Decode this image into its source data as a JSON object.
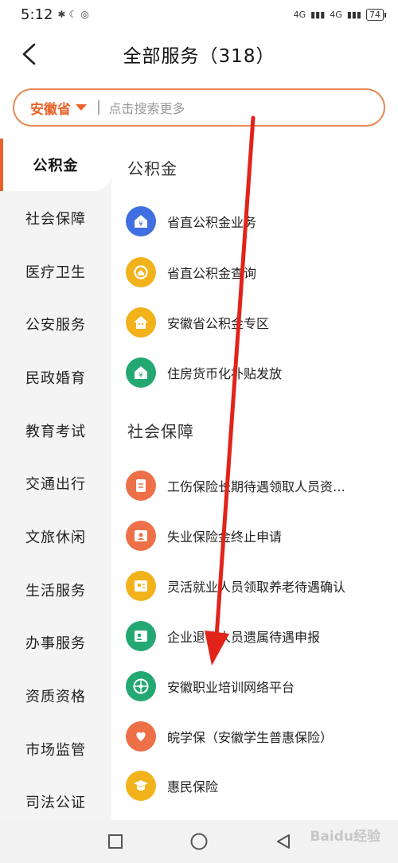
{
  "status_bar": {
    "time": "5:12",
    "network": "4G",
    "battery": "74"
  },
  "header": {
    "title": "全部服务（318）"
  },
  "search": {
    "province": "安徽省",
    "placeholder": "点击搜索更多"
  },
  "sidebar": {
    "items": [
      {
        "label": "公积金",
        "active": true
      },
      {
        "label": "社会保障"
      },
      {
        "label": "医疗卫生"
      },
      {
        "label": "公安服务"
      },
      {
        "label": "民政婚育"
      },
      {
        "label": "教育考试"
      },
      {
        "label": "交通出行"
      },
      {
        "label": "文旅休闲"
      },
      {
        "label": "生活服务"
      },
      {
        "label": "办事服务"
      },
      {
        "label": "资质资格"
      },
      {
        "label": "市场监管"
      },
      {
        "label": "司法公证"
      }
    ]
  },
  "sections": [
    {
      "title": "公积金",
      "items": [
        {
          "label": "省直公积金业务",
          "icon": "house-yen-icon",
          "color": "#3f6fe0"
        },
        {
          "label": "省直公积金查询",
          "icon": "search-house-icon",
          "color": "#f2b21b"
        },
        {
          "label": "安徽省公积金专区",
          "icon": "house-zone-icon",
          "color": "#f2b21b"
        },
        {
          "label": "住房货币化补贴发放",
          "icon": "house-subsidy-icon",
          "color": "#23a872"
        }
      ]
    },
    {
      "title": "社会保障",
      "items": [
        {
          "label": "工伤保险长期待遇领取人员资…",
          "icon": "document-icon",
          "color": "#ee7048"
        },
        {
          "label": "失业保险金终止申请",
          "icon": "person-card-icon",
          "color": "#ee7048"
        },
        {
          "label": "灵活就业人员领取养老待遇确认",
          "icon": "person-card-icon",
          "color": "#f2b21b"
        },
        {
          "label": "企业退休人员遗属待遇申报",
          "icon": "person-edit-icon",
          "color": "#23a872"
        },
        {
          "label": "安徽职业培训网络平台",
          "icon": "network-icon",
          "color": "#23a872"
        },
        {
          "label": "皖学保（安徽学生普惠保险）",
          "icon": "heart-hands-icon",
          "color": "#ee7048"
        },
        {
          "label": "惠民保险",
          "icon": "graduation-shield-icon",
          "color": "#f2b21b"
        }
      ]
    }
  ],
  "watermark": "Baidu经验",
  "colors": {
    "accent": "#e8632a",
    "annotation_arrow": "#e2231a"
  }
}
